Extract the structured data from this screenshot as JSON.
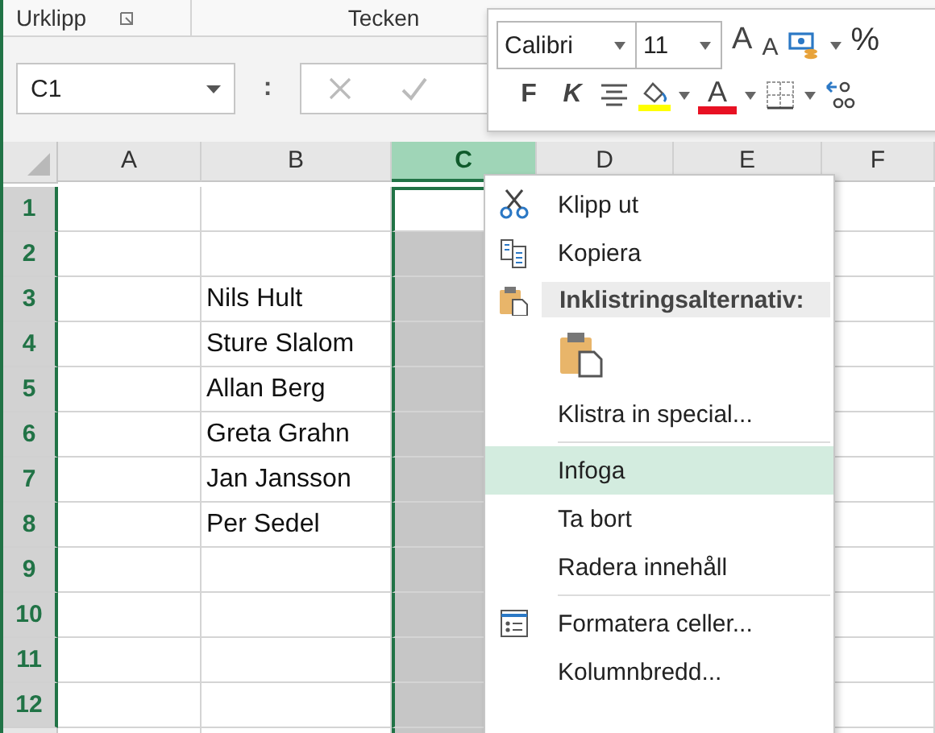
{
  "ribbon": {
    "groups": [
      {
        "label": "Urklipp",
        "launcher": true
      },
      {
        "label": "Tecken",
        "launcher": false
      }
    ]
  },
  "name_box": {
    "value": "C1"
  },
  "formula_bar": {
    "separator": ":"
  },
  "sheet": {
    "columns": [
      {
        "label": "A",
        "selected": false
      },
      {
        "label": "B",
        "selected": false
      },
      {
        "label": "C",
        "selected": true
      },
      {
        "label": "D",
        "selected": false
      },
      {
        "label": "E",
        "selected": false
      },
      {
        "label": "F",
        "selected": false
      }
    ],
    "rows": [
      {
        "header": "1",
        "highlighted": true,
        "active": true,
        "cells": [
          null,
          null,
          null,
          null,
          null,
          null
        ]
      },
      {
        "header": "2",
        "highlighted": true,
        "active": false,
        "cells": [
          null,
          null,
          null,
          null,
          null,
          null
        ]
      },
      {
        "header": "3",
        "highlighted": true,
        "active": false,
        "cells": [
          null,
          "Nils Hult",
          null,
          null,
          null,
          null
        ]
      },
      {
        "header": "4",
        "highlighted": true,
        "active": false,
        "cells": [
          null,
          "Sture Slalom",
          null,
          null,
          null,
          null
        ]
      },
      {
        "header": "5",
        "highlighted": true,
        "active": false,
        "cells": [
          null,
          "Allan Berg",
          null,
          null,
          null,
          null
        ]
      },
      {
        "header": "6",
        "highlighted": true,
        "active": false,
        "cells": [
          null,
          "Greta Grahn",
          null,
          null,
          null,
          null
        ]
      },
      {
        "header": "7",
        "highlighted": true,
        "active": false,
        "cells": [
          null,
          "Jan Jansson",
          null,
          null,
          null,
          null
        ]
      },
      {
        "header": "8",
        "highlighted": true,
        "active": false,
        "cells": [
          null,
          "Per Sedel",
          null,
          null,
          null,
          null
        ]
      },
      {
        "header": "9",
        "highlighted": true,
        "active": false,
        "cells": [
          null,
          null,
          null,
          null,
          null,
          null
        ]
      },
      {
        "header": "10",
        "highlighted": true,
        "active": false,
        "cells": [
          null,
          null,
          null,
          null,
          null,
          null
        ]
      },
      {
        "header": "11",
        "highlighted": true,
        "active": false,
        "cells": [
          null,
          null,
          null,
          null,
          null,
          null
        ]
      },
      {
        "header": "12",
        "highlighted": true,
        "active": false,
        "cells": [
          null,
          null,
          null,
          null,
          null,
          null
        ]
      }
    ]
  },
  "mini_toolbar": {
    "font": "Calibri",
    "size": "11",
    "grow_font": "A",
    "shrink_font": "A",
    "percent": "%",
    "bold": "F",
    "italic": "K",
    "font_color_letter": "A"
  },
  "context_menu": {
    "items": [
      {
        "kind": "item",
        "label": "Klipp ut",
        "selected": false
      },
      {
        "kind": "item",
        "label": "Kopiera",
        "selected": false
      },
      {
        "kind": "header",
        "label": "Inklistringsalternativ:"
      },
      {
        "kind": "paste-option"
      },
      {
        "kind": "item",
        "label": "Klistra in special...",
        "selected": false
      },
      {
        "kind": "separator"
      },
      {
        "kind": "item",
        "label": "Infoga",
        "selected": true
      },
      {
        "kind": "item",
        "label": "Ta bort",
        "selected": false
      },
      {
        "kind": "item",
        "label": "Radera innehåll",
        "selected": false
      },
      {
        "kind": "separator"
      },
      {
        "kind": "item",
        "label": "Formatera celler...",
        "selected": false
      },
      {
        "kind": "item",
        "label": "Kolumnbredd...",
        "selected": false
      }
    ]
  }
}
